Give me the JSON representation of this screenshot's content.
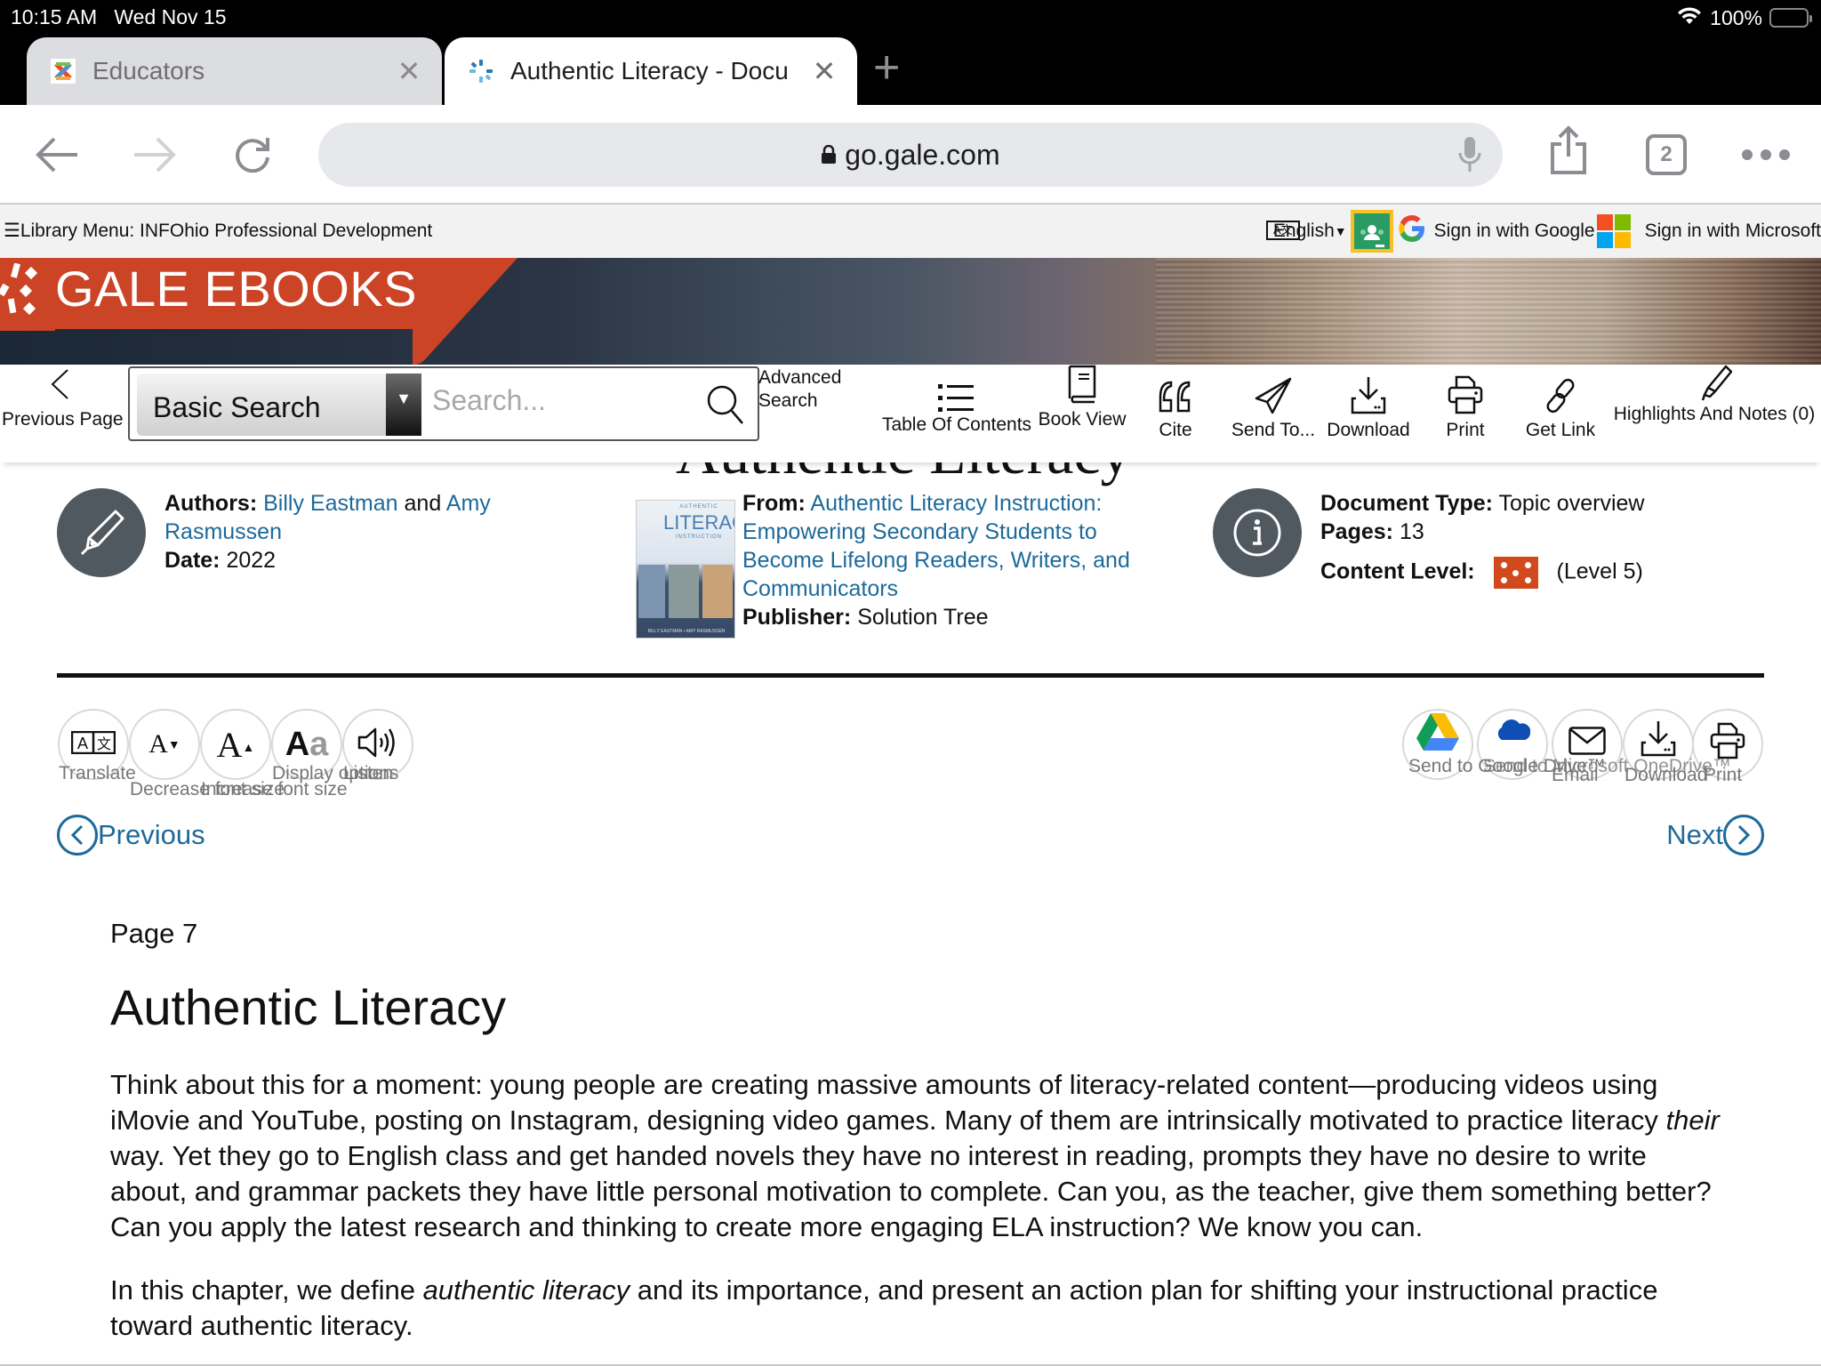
{
  "status_bar": {
    "time": "10:15 AM",
    "date": "Wed Nov 15",
    "battery": "100%",
    "wifi_icon": "wifi-icon",
    "battery_level": 1.0
  },
  "browser": {
    "tabs": [
      {
        "title": "Educators",
        "active": false,
        "favicon": "joomla-icon"
      },
      {
        "title": "Authentic Literacy - Docu",
        "active": true,
        "favicon": "gale-icon"
      }
    ],
    "new_tab_label": "+",
    "url": "go.gale.com",
    "tab_count": "2",
    "icons": {
      "back": "back-arrow-icon",
      "forward": "forward-arrow-icon",
      "reload": "reload-icon",
      "lock": "lock-icon",
      "mic": "mic-icon",
      "share": "share-icon",
      "tabs": "tabs-icon",
      "more": "more-icon"
    }
  },
  "library_bar": {
    "menu_label": "Library Menu: INFOhio Professional Development",
    "language": "English",
    "sign_in_google": "Sign in with Google",
    "sign_in_microsoft": "Sign in with Microsoft"
  },
  "banner": {
    "brand": "GALE EBOOKS",
    "brand_color": "#cc4426"
  },
  "toolbar": {
    "previous_page": "Previous Page",
    "search_type": "Basic Search",
    "search_placeholder": "Search...",
    "advanced_search_line1": "Advanced",
    "advanced_search_line2": "Search",
    "items": [
      {
        "label": "Table Of Contents",
        "icon": "list-icon"
      },
      {
        "label": "Book View",
        "icon": "book-icon"
      },
      {
        "label": "Cite",
        "icon": "quote-icon"
      },
      {
        "label": "Send To...",
        "icon": "paper-plane-icon"
      },
      {
        "label": "Download",
        "icon": "download-icon"
      },
      {
        "label": "Print",
        "icon": "print-icon"
      },
      {
        "label": "Get Link",
        "icon": "link-icon"
      },
      {
        "label": "Highlights And Notes (0)",
        "icon": "highlighter-icon"
      }
    ]
  },
  "document": {
    "title_partial": "Authentic Literacy",
    "authors_label": "Authors:",
    "author1": "Billy Eastman",
    "authors_and": " and ",
    "author2_line1": "Amy",
    "author2_line2": "Rasmussen",
    "date_label": "Date:",
    "date": "2022",
    "from_label": "From:",
    "from_line1": "Authentic Literacy Instruction:",
    "from_line2": "Empowering Secondary Students to",
    "from_line3": "Become Lifelong Readers, Writers, and",
    "from_line4": "Communicators",
    "publisher_label": "Publisher:",
    "publisher": "Solution Tree",
    "doc_type_label": "Document Type:",
    "doc_type": "Topic overview",
    "pages_label": "Pages:",
    "pages": "13",
    "content_level_label": "Content Level:",
    "content_level": "(Level 5)",
    "content_level_value": 5,
    "cover": {
      "line1": "AUTHENTIC",
      "line2": "LITERACY",
      "line3": "INSTRUCTION",
      "authors": "BILLY EASTMAN • AMY RASMUSSEN"
    },
    "link_color": "#1d6a9a"
  },
  "tools_left": [
    {
      "label": "Translate",
      "icon": "translate-icon"
    },
    {
      "label": "Decrease font size",
      "icon": "decrease-font-icon"
    },
    {
      "label": "Increase font size",
      "icon": "increase-font-icon"
    },
    {
      "label": "Display options",
      "icon": "display-options-icon"
    },
    {
      "label": "Listen",
      "icon": "speaker-icon"
    }
  ],
  "tools_right": [
    {
      "label": "Send to Google Drive™",
      "icon": "google-drive-icon"
    },
    {
      "label": "Send to Microsoft OneDrive™",
      "icon": "onedrive-icon"
    },
    {
      "label": "Email",
      "icon": "email-icon"
    },
    {
      "label": "Download",
      "icon": "download-icon"
    },
    {
      "label": "Print",
      "icon": "print-icon"
    }
  ],
  "nav": {
    "previous": "Previous",
    "next": "Next"
  },
  "content": {
    "page_label": "Page 7",
    "heading": "Authentic Literacy",
    "p1_a": "Think about this for a moment: young people are creating massive amounts of literacy-related content—producing videos using iMovie and YouTube, posting on Instagram, designing video games. Many of them are intrinsically motivated to practice literacy ",
    "p1_em": "their",
    "p1_b": " way. Yet they go to English class and get handed novels they have no interest in reading, prompts they have no desire to write about, and grammar packets they have little personal motivation to complete. Can you, as the teacher, give them something better? Can you apply the latest research and thinking to create more engaging ELA instruction? We know you can.",
    "p2_a": "In this chapter, we define ",
    "p2_em": "authentic literacy",
    "p2_b": " and its importance, and present an action plan for shifting your instructional practice toward authentic literacy."
  }
}
